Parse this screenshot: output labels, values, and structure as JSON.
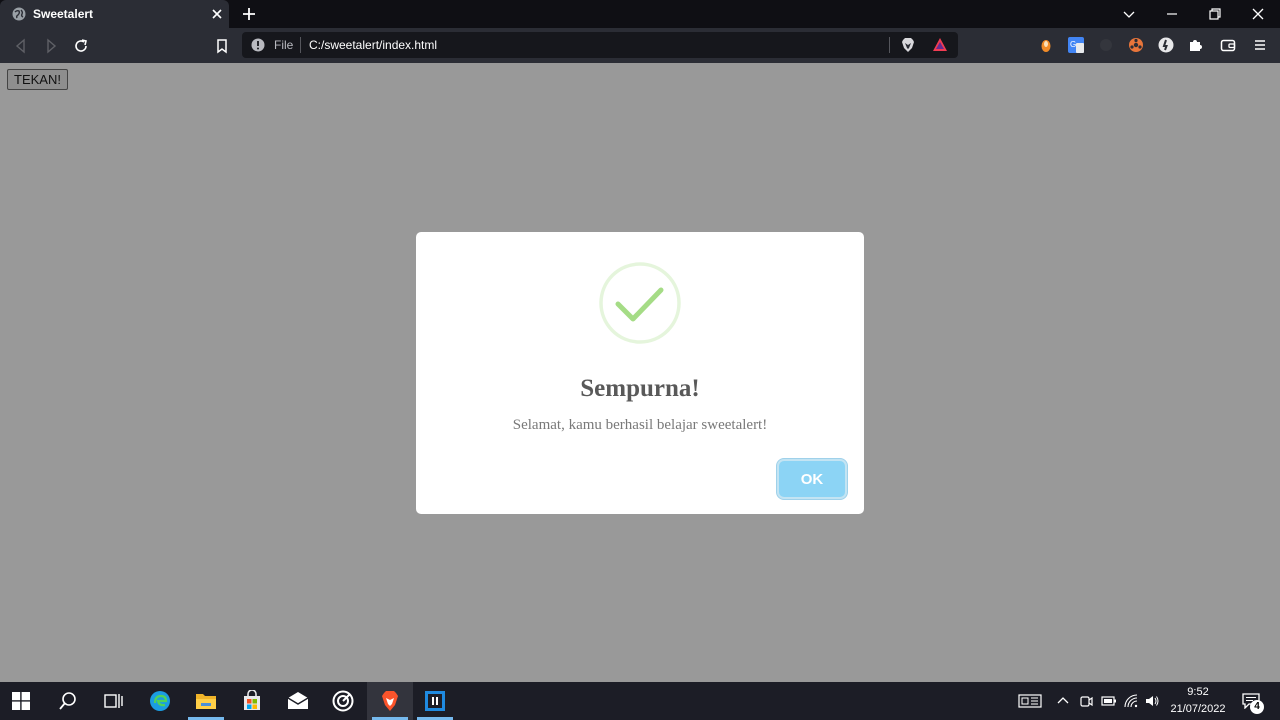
{
  "browser": {
    "tab_title": "Sweetalert",
    "omnibox": {
      "scheme_label": "File",
      "url": "C:/sweetalert/index.html"
    }
  },
  "page": {
    "trigger_button_label": "TEKAN!"
  },
  "alert": {
    "title": "Sempurna!",
    "text": "Selamat, kamu berhasil belajar sweetalert!",
    "confirm_label": "OK",
    "icon": "success-check-icon",
    "colors": {
      "check": "#a5dc86",
      "ring": "#e5f5dc",
      "button": "#8cd4f5"
    }
  },
  "taskbar": {
    "time": "9:52",
    "date": "21/07/2022",
    "notification_count": "4"
  },
  "colors": {
    "overlay": "#999999",
    "tab_bar": "#0f0f14",
    "toolbar": "#2b2d35",
    "taskbar": "#1c1d26"
  }
}
